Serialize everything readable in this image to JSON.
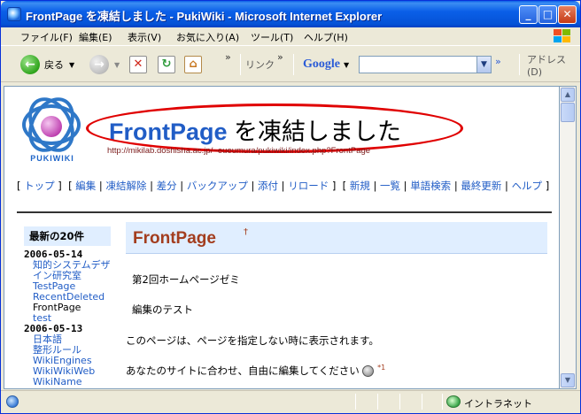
{
  "window": {
    "title": "FrontPage を凍結しました - PukiWiki - Microsoft Internet Explorer"
  },
  "menubar": {
    "items": [
      "ファイル(F)",
      "編集(E)",
      "表示(V)",
      "お気に入り(A)",
      "ツール(T)",
      "ヘルプ(H)"
    ]
  },
  "toolbar": {
    "back_label": "戻る",
    "links_label": "リンク",
    "google_label": "Google",
    "address_label": "アドレス(D)"
  },
  "page": {
    "logo_text": "PUKIWIKI",
    "title_page": "FrontPage",
    "title_suffix": " を凍結しました",
    "url": "http://mikilab.doshisha.ac.jp/~eueumura/pukiwiki/index.php?FrontPage",
    "nav": {
      "top": "トップ",
      "edit": "編集",
      "unfreeze": "凍結解除",
      "diff": "差分",
      "backup": "バックアップ",
      "attach": "添付",
      "reload": "リロード",
      "new": "新規",
      "list": "一覧",
      "search": "単語検索",
      "recent": "最終更新",
      "help": "ヘルプ"
    },
    "side": {
      "heading": "最新の20件",
      "groups": [
        {
          "date": "2006-05-14",
          "items": [
            "知的システムデザイン研究室",
            "TestPage",
            "RecentDeleted",
            "FrontPage",
            "test"
          ]
        },
        {
          "date": "2006-05-13",
          "items": [
            "日本語",
            "整形ルール",
            "WikiEngines",
            "WikiWikiWeb",
            "WikiName"
          ]
        }
      ]
    },
    "heading": "FrontPage",
    "heading_mark": "†",
    "lines": [
      "第2回ホームページゼミ",
      "編集のテスト",
      "このページは、ページを指定しない時に表示されます。",
      "あなたのサイトに合わせ、自由に編集してください"
    ],
    "note_mark": "*1"
  },
  "statusbar": {
    "zone": "イントラネット"
  }
}
